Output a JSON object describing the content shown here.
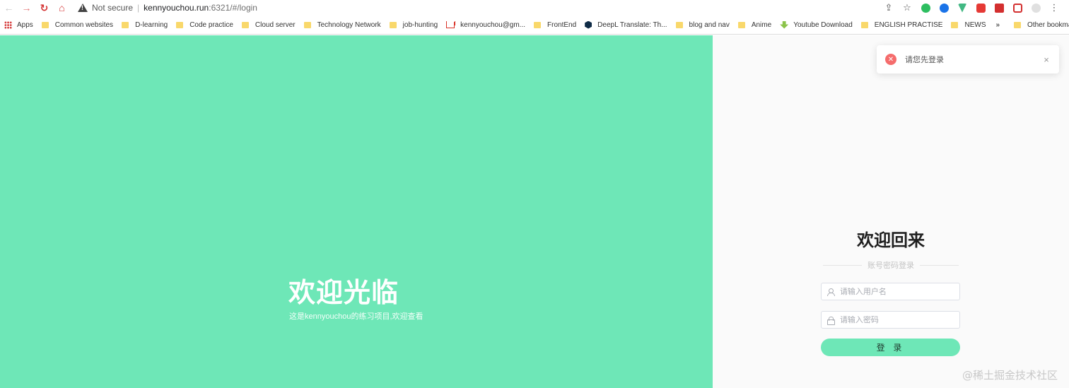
{
  "browser": {
    "security_label": "Not secure",
    "url_host": "kennyoucho​u.run",
    "url_rest": ":6321/#/login",
    "nav": {
      "back_icon": "back-arrow-icon",
      "forward_icon": "forward-arrow-icon",
      "reload_icon": "reload-icon",
      "home_icon": "home-icon"
    }
  },
  "bookmarks": [
    {
      "label": "Apps",
      "icon": "apps-grid-icon"
    },
    {
      "label": "Common websites",
      "icon": "folder-icon"
    },
    {
      "label": "D-learning",
      "icon": "folder-icon"
    },
    {
      "label": "Code practice",
      "icon": "folder-icon"
    },
    {
      "label": "Cloud server",
      "icon": "folder-icon"
    },
    {
      "label": "Technology Network",
      "icon": "folder-icon"
    },
    {
      "label": "job-hunting",
      "icon": "folder-icon"
    },
    {
      "label": "kennyouchou@gm...",
      "icon": "gmail-icon"
    },
    {
      "label": "FrontEnd",
      "icon": "folder-icon"
    },
    {
      "label": "DeepL Translate: Th...",
      "icon": "deepl-icon"
    },
    {
      "label": "blog and nav",
      "icon": "folder-icon"
    },
    {
      "label": "Anime",
      "icon": "folder-icon"
    },
    {
      "label": "Youtube Download",
      "icon": "download-icon"
    },
    {
      "label": "ENGLISH PRACTISE",
      "icon": "folder-icon"
    },
    {
      "label": "NEWS",
      "icon": "folder-icon"
    }
  ],
  "bookmarks_overflow": "»",
  "other_bookmarks": "Other bookmarks",
  "left": {
    "title": "欢迎光临",
    "subtitle": "这是kennyouchou的练习项目,欢迎查看"
  },
  "login": {
    "title": "欢迎回来",
    "divider_text": "账号密码登录",
    "username_placeholder": "请输入用户名",
    "password_placeholder": "请输入密码",
    "submit_label": "登 录"
  },
  "toast": {
    "message": "请您先登录",
    "close_glyph": "×"
  },
  "watermark": "@稀土掘金技术社区",
  "colors": {
    "accent": "#6ee7b7",
    "error": "#f56c6c",
    "right_bg": "#fafafa"
  }
}
